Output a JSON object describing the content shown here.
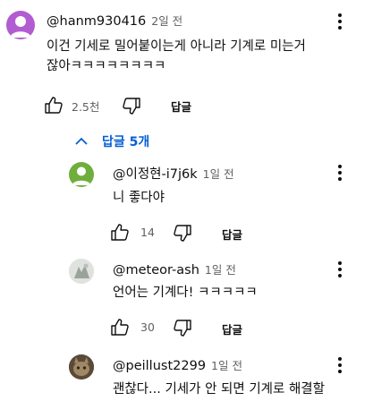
{
  "comment": {
    "author": "@hanm930416",
    "time": "2일 전",
    "text_line1": "이건 기세로 밀어붙이는게 아니라 기계로 미는거",
    "text_line2": "잖아ㅋㅋㅋㅋㅋㅋㅋㅋ",
    "likes": "2.5천",
    "reply_label": "답글",
    "avatar_color": "#b15cd1"
  },
  "replies_toggle": {
    "label": "답글 5개",
    "color": "#065fd4"
  },
  "replies": [
    {
      "author": "@이정현-i7j6k",
      "time": "1일 전",
      "text": "니 좋다야",
      "likes": "14",
      "reply_label": "답글",
      "avatar_color": "#6fae3c"
    },
    {
      "author": "@meteor-ash",
      "time": "1일 전",
      "text": "언어는 기계다! ㅋㅋㅋㅋㅋ",
      "likes": "30",
      "reply_label": "답글"
    },
    {
      "author": "@peillust2299",
      "time": "1일 전",
      "text": "괜찮다... 기세가 안 되면 기계로 해결할"
    }
  ]
}
